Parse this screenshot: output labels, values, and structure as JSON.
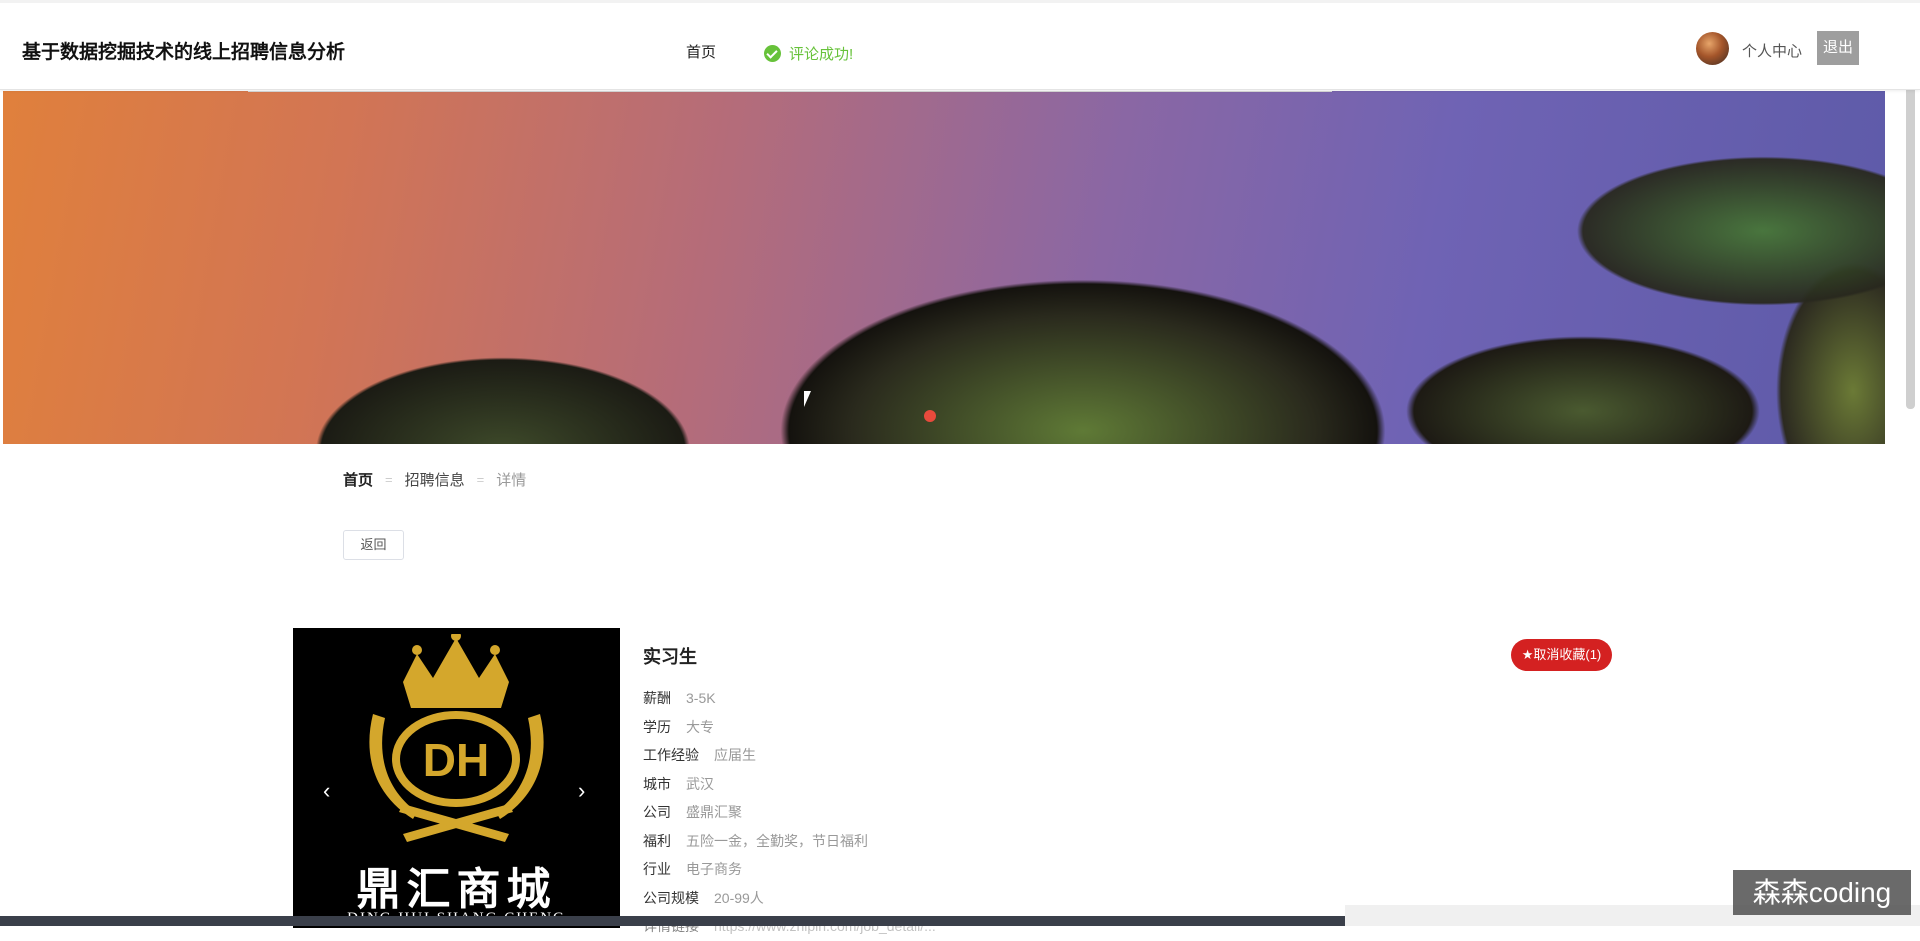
{
  "header": {
    "site_title": "基于数据挖掘技术的线上招聘信息分析",
    "nav_home": "首页",
    "toast": "评论成功!",
    "user_center": "个人中心",
    "logout": "退出"
  },
  "breadcrumb": {
    "home": "首页",
    "separator": "=",
    "list": "招聘信息",
    "current": "详情"
  },
  "back_label": "返回",
  "carousel": {
    "logo_initials": "DH",
    "logo_cn": "鼎汇商城",
    "logo_en": "DING HUI SHANG CHENG",
    "prev_icon": "‹",
    "next_icon": "›"
  },
  "job": {
    "title": "实习生",
    "favorite_label": "★取消收藏(1)",
    "fields": [
      {
        "label": "薪酬",
        "value": "3-5K"
      },
      {
        "label": "学历",
        "value": "大专"
      },
      {
        "label": "工作经验",
        "value": "应届生"
      },
      {
        "label": "城市",
        "value": "武汉"
      },
      {
        "label": "公司",
        "value": "盛鼎汇聚"
      },
      {
        "label": "福利",
        "value": "五险一金，全勤奖，节日福利"
      },
      {
        "label": "行业",
        "value": "电子商务"
      },
      {
        "label": "公司规模",
        "value": "20-99人"
      },
      {
        "label": "详情链接",
        "value": "https://www.zhipin.com/job_detail/..."
      }
    ]
  },
  "watermark": "森森coding",
  "colors": {
    "toast_green": "#67c23a",
    "favorite_red": "#d42121",
    "banner_dot": "#e84a3c",
    "logo_gold": "#d4a72c"
  }
}
